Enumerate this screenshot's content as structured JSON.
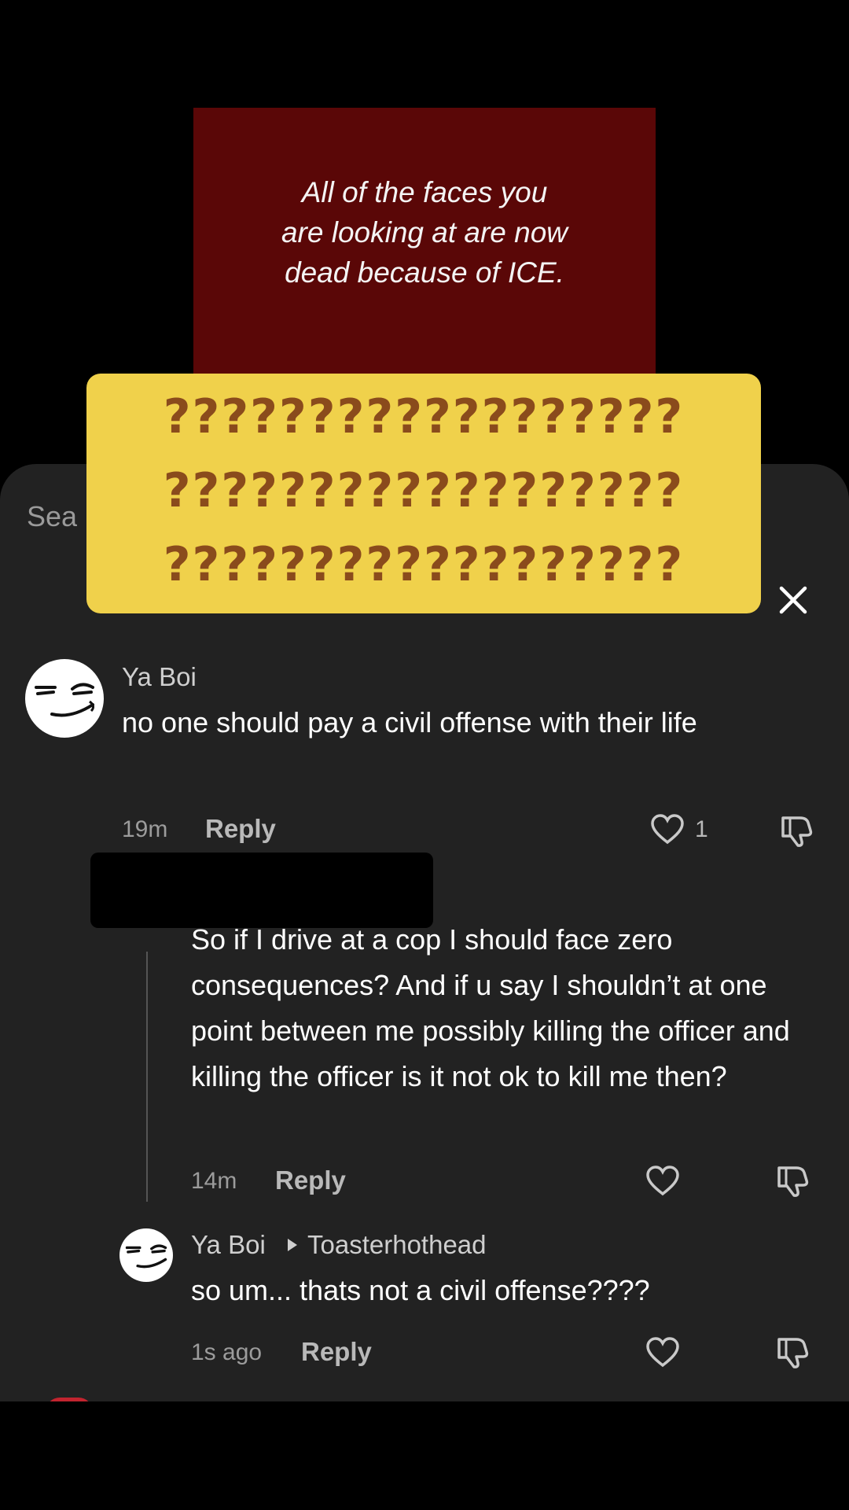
{
  "video": {
    "caption": "All of the faces you\nare looking at are now\ndead because of ICE."
  },
  "sticker": {
    "lines": [
      "??????????????????",
      "??????????????????",
      "??????????????????"
    ]
  },
  "sheet": {
    "search_hint": "Sea"
  },
  "comments": [
    {
      "username": "Ya Boi",
      "text": "no one should pay a civil offense with their life",
      "time": "19m",
      "reply_label": "Reply",
      "likes": "1"
    },
    {
      "username": "",
      "text": "So if I drive at a cop I should face zero consequences? And if u say I shouldn’t at one point between me possibly killing the officer and killing the officer is it not ok to kill me then?",
      "time": "14m",
      "reply_label": "Reply",
      "likes": ""
    },
    {
      "username": "Ya Boi",
      "reply_to": "Toasterhothead",
      "text": "so um... thats not a civil offense????",
      "time": "1s ago",
      "reply_label": "Reply",
      "likes": ""
    }
  ],
  "icons": {
    "close": "close-icon",
    "like": "heart-icon",
    "dislike": "thumbs-down-icon",
    "reply_arrow": "triangle-right-icon"
  },
  "colors": {
    "sheet_bg": "#222222",
    "sticker_bg": "#f0d14b",
    "sticker_text": "#8a4b1c",
    "video_bg": "#5a0707"
  }
}
